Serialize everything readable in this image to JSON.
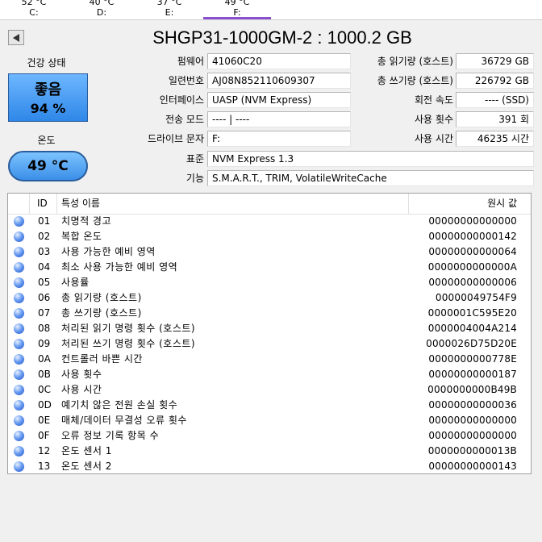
{
  "drive_tabs": [
    {
      "temp": "52 °C",
      "letter": "C:"
    },
    {
      "temp": "40 °C",
      "letter": "D:"
    },
    {
      "temp": "37 °C",
      "letter": "E:"
    },
    {
      "temp": "49 °C",
      "letter": "F:"
    }
  ],
  "header": {
    "title": "SHGP31-1000GM-2 : 1000.2 GB"
  },
  "health": {
    "label": "건강 상태",
    "status": "좋음",
    "percent": "94 %"
  },
  "temperature": {
    "label": "온도",
    "value": "49 °C"
  },
  "info_left": [
    {
      "label": "펌웨어",
      "value": "41060C20"
    },
    {
      "label": "일련번호",
      "value": "AJ08N852110609307"
    },
    {
      "label": "인터페이스",
      "value": "UASP (NVM Express)"
    },
    {
      "label": "전송 모드",
      "value": "---- | ----"
    },
    {
      "label": "드라이브 문자",
      "value": "F:"
    }
  ],
  "info_right": [
    {
      "label": "총 읽기량 (호스트)",
      "value": "36729 GB"
    },
    {
      "label": "총 쓰기량 (호스트)",
      "value": "226792 GB"
    },
    {
      "label": "회전 속도",
      "value": "---- (SSD)"
    },
    {
      "label": "사용 횟수",
      "value": "391 회"
    },
    {
      "label": "사용 시간",
      "value": "46235 시간"
    }
  ],
  "info_wide": [
    {
      "label": "표준",
      "value": "NVM Express 1.3"
    },
    {
      "label": "기능",
      "value": "S.M.A.R.T., TRIM, VolatileWriteCache"
    }
  ],
  "smart_table": {
    "columns": {
      "id": "ID",
      "name": "특성 이름",
      "raw": "원시 값"
    },
    "rows": [
      {
        "id": "01",
        "name": "치명적 경고",
        "raw": "00000000000000"
      },
      {
        "id": "02",
        "name": "복합 온도",
        "raw": "00000000000142"
      },
      {
        "id": "03",
        "name": "사용 가능한 예비 영역",
        "raw": "00000000000064"
      },
      {
        "id": "04",
        "name": "최소 사용 가능한 예비 영역",
        "raw": "0000000000000A"
      },
      {
        "id": "05",
        "name": "사용률",
        "raw": "00000000000006"
      },
      {
        "id": "06",
        "name": "총 읽기량 (호스트)",
        "raw": "00000049754F9"
      },
      {
        "id": "07",
        "name": "총 쓰기량 (호스트)",
        "raw": "0000001C595E20"
      },
      {
        "id": "08",
        "name": "처리된 읽기 명령 횟수 (호스트)",
        "raw": "0000004004A214"
      },
      {
        "id": "09",
        "name": "처리된 쓰기 명령 횟수 (호스트)",
        "raw": "0000026D75D20E"
      },
      {
        "id": "0A",
        "name": "컨트롤러 바쁜 시간",
        "raw": "0000000000778E"
      },
      {
        "id": "0B",
        "name": "사용 횟수",
        "raw": "00000000000187"
      },
      {
        "id": "0C",
        "name": "사용 시간",
        "raw": "0000000000B49B"
      },
      {
        "id": "0D",
        "name": "예기치 않은 전원 손실 횟수",
        "raw": "00000000000036"
      },
      {
        "id": "0E",
        "name": "매체/데이터 무결성 오류 횟수",
        "raw": "00000000000000"
      },
      {
        "id": "0F",
        "name": "오류 정보 기록 항목 수",
        "raw": "00000000000000"
      },
      {
        "id": "12",
        "name": "온도 센서 1",
        "raw": "0000000000013B"
      },
      {
        "id": "13",
        "name": "온도 센서 2",
        "raw": "00000000000143"
      }
    ]
  },
  "colors": {
    "accent": "#8a4fd0",
    "health_good": "#2f87e8",
    "status_dot": "#3a6fe0"
  },
  "icons": {
    "back": "triangle-left-icon",
    "status": "blue-circle-icon"
  }
}
